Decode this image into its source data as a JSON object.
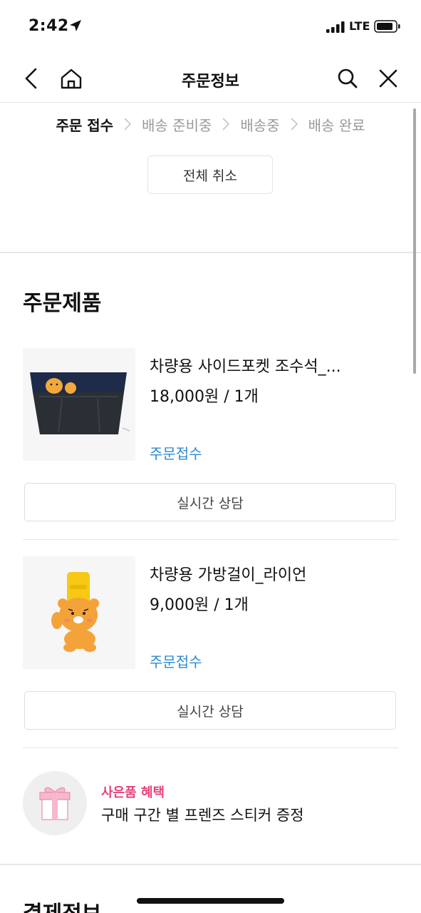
{
  "status_bar": {
    "time": "2:42",
    "network": "LTE"
  },
  "nav": {
    "title": "주문정보"
  },
  "steps": [
    {
      "label": "주문 접수",
      "active": true
    },
    {
      "label": "배송 준비중",
      "active": false
    },
    {
      "label": "배송중",
      "active": false
    },
    {
      "label": "배송 완료",
      "active": false
    }
  ],
  "cancel_all_label": "전체 취소",
  "order_section": {
    "title": "주문제품",
    "products": [
      {
        "name": "차량용 사이드포켓 조수석_...",
        "price": "18,000원 / 1개",
        "status": "주문접수",
        "consult_label": "실시간 상담"
      },
      {
        "name": "차량용 가방걸이_라이언",
        "price": "9,000원 / 1개",
        "status": "주문접수",
        "consult_label": "실시간 상담"
      }
    ]
  },
  "gift": {
    "label": "사은품 혜택",
    "description": "구매 구간 별 프렌즈 스티커 증정"
  },
  "payment_section": {
    "title": "결제정보"
  },
  "colors": {
    "status_blue": "#2b8ad4",
    "gift_pink": "#e8417a"
  }
}
